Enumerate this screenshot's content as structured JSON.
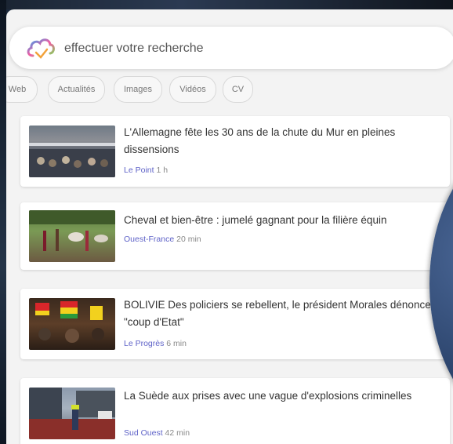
{
  "search": {
    "placeholder": "effectuer votre recherche"
  },
  "tabs": [
    {
      "label": "Web"
    },
    {
      "label": "Actualités"
    },
    {
      "label": "Images"
    },
    {
      "label": "Vidéos"
    },
    {
      "label": "CV"
    }
  ],
  "articles": [
    {
      "title": "L'Allemagne fête les 30 ans de la chute du Mur en pleines dissensions",
      "source": "Le Point",
      "time": "1 h"
    },
    {
      "title": "Cheval et bien-être : jumelé gagnant pour la filière équin",
      "source": "Ouest-France",
      "time": "20 min"
    },
    {
      "title": "BOLIVIE Des policiers se rebellent, le président Morales dénonce un \"coup d'Etat\"",
      "source": "Le Progrès",
      "time": "6 min"
    },
    {
      "title": "La Suède aux prises avec une vague d'explosions criminelles",
      "source": "Sud Ouest",
      "time": "42 min"
    }
  ],
  "colors": {
    "source_link": "#5f63c8",
    "panel_bg": "#f3f3f3",
    "accent_logo": [
      "#2ea3f2",
      "#f25ca2",
      "#7ed957"
    ]
  },
  "icons": {
    "logo": "cloud-logo-icon"
  }
}
